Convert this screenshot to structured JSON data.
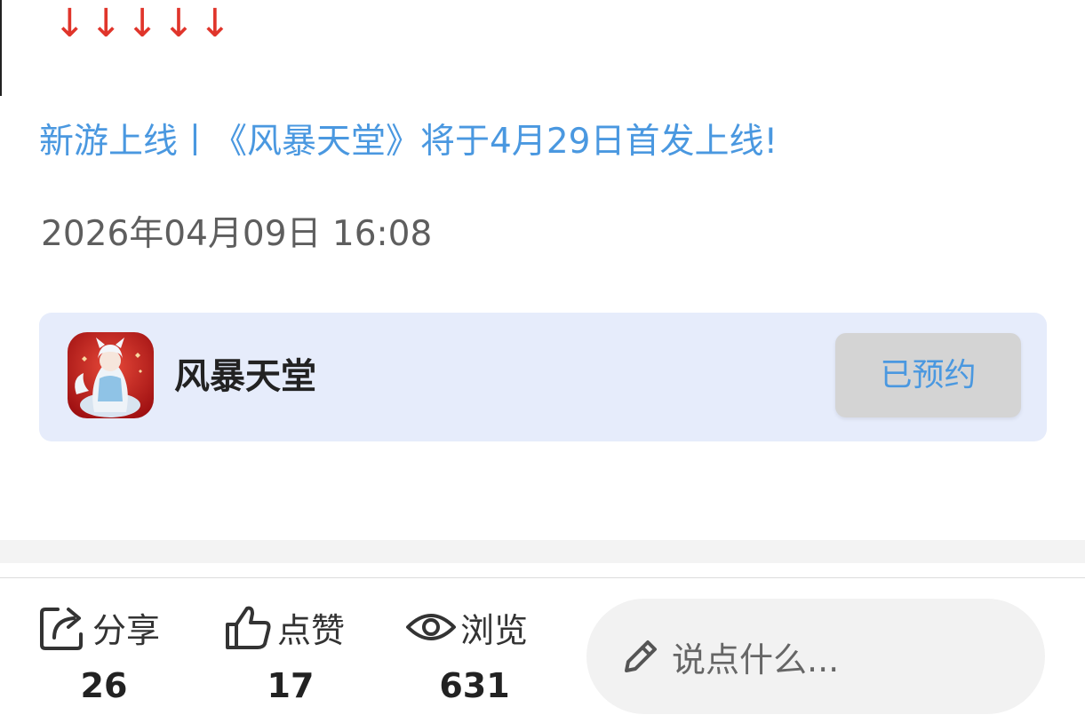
{
  "arrows": "↓↓↓↓↓",
  "article": {
    "headline": "新游上线丨《风暴天堂》将于4月29日首发上线!",
    "datetime": "2026年04月09日 16:08"
  },
  "game_card": {
    "name": "风暴天堂",
    "reserve_label": "已预约",
    "icon_name": "game-app-icon"
  },
  "actions": {
    "share": {
      "label": "分享",
      "count": "26",
      "icon": "share-icon"
    },
    "like": {
      "label": "点赞",
      "count": "17",
      "icon": "thumbs-up-icon"
    },
    "view": {
      "label": "浏览",
      "count": "631",
      "icon": "eye-icon"
    }
  },
  "comment": {
    "placeholder": "说点什么...",
    "icon": "pencil-icon"
  },
  "colors": {
    "headline": "#4a98e0",
    "arrows": "#e0352b",
    "card_bg": "#e6ecfb",
    "button_bg": "#d4d4d4",
    "button_text": "#4a98e0"
  }
}
